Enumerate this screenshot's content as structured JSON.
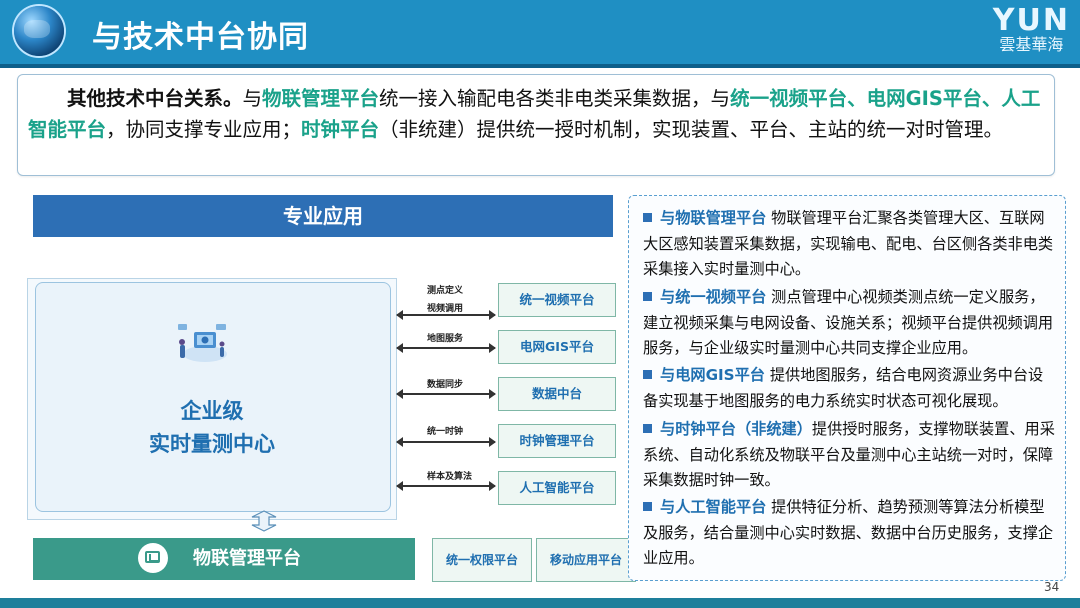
{
  "header": {
    "title": "与技术中台协同",
    "logo_main": "YUN",
    "logo_sub": "雲基華海"
  },
  "intro": {
    "lead": "其他技术中台关系。",
    "t1": "与",
    "h1": "物联管理平台",
    "t2": "统一接入输配电各类非电类采集数据，与",
    "h2": "统一视频平台、电网GIS平台、人工智能平台",
    "t3": "，协同支撑专业应用；",
    "h3": "时钟平台",
    "t4": "（非统建）提供统一授时机制，实现装置、平台、主站的统一对时管理。"
  },
  "diagram": {
    "app_bar": "专业应用",
    "center_line1": "企业级",
    "center_line2": "实时量测中心",
    "arrows": [
      {
        "label1": "测点定义",
        "label2": "视频调用"
      },
      {
        "label1": "地图服务"
      },
      {
        "label1": "数据同步"
      },
      {
        "label1": "统一时钟"
      },
      {
        "label1": "样本及算法"
      }
    ],
    "platforms": [
      "统一视频平台",
      "电网GIS平台",
      "数据中台",
      "时钟管理平台",
      "人工智能平台"
    ],
    "iot_bar": "物联管理平台",
    "bottom_boxes": [
      "统一权限平台",
      "移动应用平台"
    ]
  },
  "right_panel": {
    "items": [
      {
        "head": "与物联管理平台",
        "body": " 物联管理平台汇聚各类管理大区、互联网大区感知装置采集数据，实现输电、配电、台区侧各类非电类采集接入实时量测中心。"
      },
      {
        "head": "与统一视频平台",
        "body": " 测点管理中心视频类测点统一定义服务，建立视频采集与电网设备、设施关系；视频平台提供视频调用服务，与企业级实时量测中心共同支撑企业应用。"
      },
      {
        "head": "与电网GIS平台",
        "body": " 提供地图服务，结合电网资源业务中台设备实现基于地图服务的电力系统实时状态可视化展现。"
      },
      {
        "head": "与时钟平台（非统建）",
        "body": "提供授时服务，支撑物联装置、用采系统、自动化系统及物联平台及量测中心主站统一对时，保障采集数据时钟一致。"
      },
      {
        "head": "与人工智能平台",
        "body": " 提供特征分析、趋势预测等算法分析模型及服务，结合量测中心实时数据、数据中台历史服务，支撑企业应用。"
      }
    ]
  },
  "footer": {
    "page": "34"
  },
  "colors": {
    "header": "#1f8fc3",
    "highlight": "#1aa28a",
    "blue_bar": "#2d6fb5",
    "teal_bar": "#3a9a8a"
  }
}
